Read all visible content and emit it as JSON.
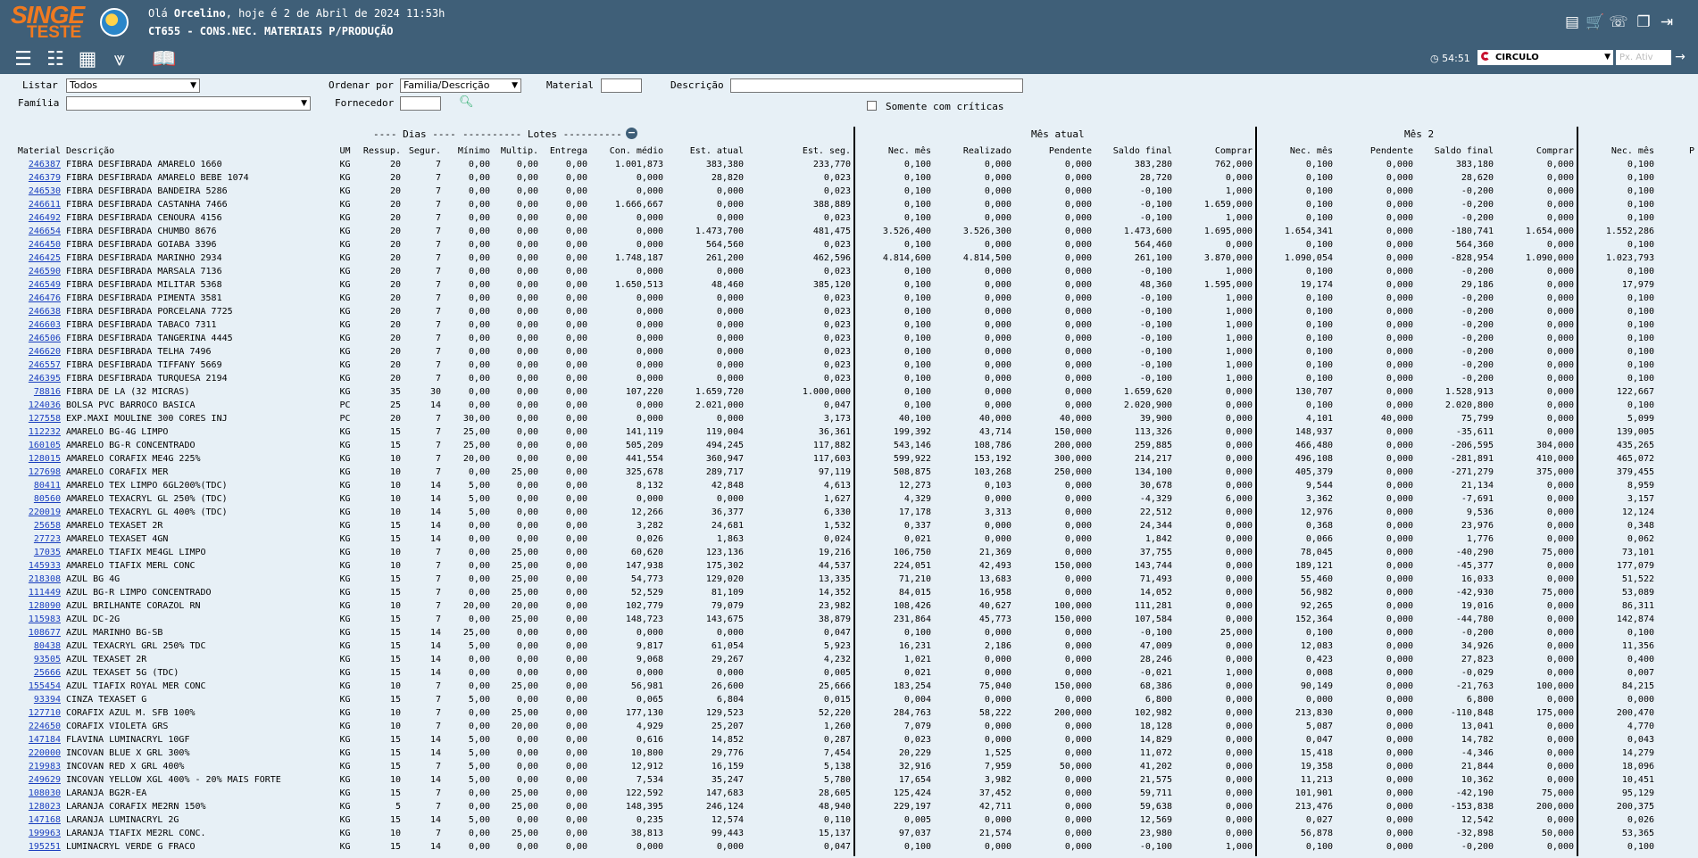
{
  "header": {
    "logo_top": "SINGE",
    "logo_bottom": "TESTE",
    "greeting_prefix": "Olá ",
    "user": "Orcelino",
    "greeting_suffix": ", hoje é 2 de Abril de 2024 11:53h",
    "page_title": "CT655 - CONS.NEC. MATERIAIS P/PRODUÇÃO"
  },
  "toolbar2": {
    "timer": "54:51",
    "empresa": "CIRCULO",
    "px_ativ_placeholder": "Px. Ativ"
  },
  "filters": {
    "listar_label": "Listar",
    "listar_value": "Todos",
    "familia_label": "Família",
    "ordenar_label": "Ordenar por",
    "ordenar_value": "Familia/Descrição",
    "fornecedor_label": "Fornecedor",
    "material_label": "Material",
    "descricao_label": "Descrição",
    "somente_label": "Somente com críticas"
  },
  "groups": {
    "dias": "---- Dias ----",
    "lotes": "---------- Lotes ----------",
    "mes_atual": "Mês atual",
    "mes2": "Mês 2"
  },
  "columns": [
    "Material",
    "Descrição",
    "UM",
    "Ressup.",
    "Segur.",
    "Mínimo",
    "Multip.",
    "Entrega",
    "Con. médio",
    "Est. atual",
    "Est. seg.",
    "Nec. mês",
    "Realizado",
    "Pendente",
    "Saldo final",
    "Comprar",
    "Nec. mês",
    "Pendente",
    "Saldo final",
    "Comprar",
    "Nec. mês",
    "P"
  ],
  "rows": [
    [
      "246387",
      "FIBRA DESFIBRADA AMARELO 1660",
      "KG",
      "20",
      "7",
      "0,00",
      "0,00",
      "0,00",
      "1.001,873",
      "383,380",
      "233,770",
      "0,100",
      "0,000",
      "0,000",
      "383,280",
      "762,000",
      "0,100",
      "0,000",
      "383,180",
      "0,000",
      "0,100"
    ],
    [
      "246379",
      "FIBRA DESFIBRADA AMARELO BEBE 1074",
      "KG",
      "20",
      "7",
      "0,00",
      "0,00",
      "0,00",
      "0,000",
      "28,820",
      "0,023",
      "0,100",
      "0,000",
      "0,000",
      "28,720",
      "0,000",
      "0,100",
      "0,000",
      "28,620",
      "0,000",
      "0,100"
    ],
    [
      "246530",
      "FIBRA DESFIBRADA BANDEIRA 5286",
      "KG",
      "20",
      "7",
      "0,00",
      "0,00",
      "0,00",
      "0,000",
      "0,000",
      "0,023",
      "0,100",
      "0,000",
      "0,000",
      "-0,100",
      "1,000",
      "0,100",
      "0,000",
      "-0,200",
      "0,000",
      "0,100"
    ],
    [
      "246611",
      "FIBRA DESFIBRADA CASTANHA 7466",
      "KG",
      "20",
      "7",
      "0,00",
      "0,00",
      "0,00",
      "1.666,667",
      "0,000",
      "388,889",
      "0,100",
      "0,000",
      "0,000",
      "-0,100",
      "1.659,000",
      "0,100",
      "0,000",
      "-0,200",
      "0,000",
      "0,100"
    ],
    [
      "246492",
      "FIBRA DESFIBRADA CENOURA 4156",
      "KG",
      "20",
      "7",
      "0,00",
      "0,00",
      "0,00",
      "0,000",
      "0,000",
      "0,023",
      "0,100",
      "0,000",
      "0,000",
      "-0,100",
      "1,000",
      "0,100",
      "0,000",
      "-0,200",
      "0,000",
      "0,100"
    ],
    [
      "246654",
      "FIBRA DESFIBRADA CHUMBO 8676",
      "KG",
      "20",
      "7",
      "0,00",
      "0,00",
      "0,00",
      "0,000",
      "1.473,700",
      "481,475",
      "3.526,400",
      "3.526,300",
      "0,000",
      "1.473,600",
      "1.695,000",
      "1.654,341",
      "0,000",
      "-180,741",
      "1.654,000",
      "1.552,286"
    ],
    [
      "246450",
      "FIBRA DESFIBRADA GOIABA 3396",
      "KG",
      "20",
      "7",
      "0,00",
      "0,00",
      "0,00",
      "0,000",
      "564,560",
      "0,023",
      "0,100",
      "0,000",
      "0,000",
      "564,460",
      "0,000",
      "0,100",
      "0,000",
      "564,360",
      "0,000",
      "0,100"
    ],
    [
      "246425",
      "FIBRA DESFIBRADA MARINHO 2934",
      "KG",
      "20",
      "7",
      "0,00",
      "0,00",
      "0,00",
      "1.748,187",
      "261,200",
      "462,596",
      "4.814,600",
      "4.814,500",
      "0,000",
      "261,100",
      "3.870,000",
      "1.090,054",
      "0,000",
      "-828,954",
      "1.090,000",
      "1.023,793"
    ],
    [
      "246590",
      "FIBRA DESFIBRADA MARSALA 7136",
      "KG",
      "20",
      "7",
      "0,00",
      "0,00",
      "0,00",
      "0,000",
      "0,000",
      "0,023",
      "0,100",
      "0,000",
      "0,000",
      "-0,100",
      "1,000",
      "0,100",
      "0,000",
      "-0,200",
      "0,000",
      "0,100"
    ],
    [
      "246549",
      "FIBRA DESFIBRADA MILITAR 5368",
      "KG",
      "20",
      "7",
      "0,00",
      "0,00",
      "0,00",
      "1.650,513",
      "48,460",
      "385,120",
      "0,100",
      "0,000",
      "0,000",
      "48,360",
      "1.595,000",
      "19,174",
      "0,000",
      "29,186",
      "0,000",
      "17,979"
    ],
    [
      "246476",
      "FIBRA DESFIBRADA PIMENTA 3581",
      "KG",
      "20",
      "7",
      "0,00",
      "0,00",
      "0,00",
      "0,000",
      "0,000",
      "0,023",
      "0,100",
      "0,000",
      "0,000",
      "-0,100",
      "1,000",
      "0,100",
      "0,000",
      "-0,200",
      "0,000",
      "0,100"
    ],
    [
      "246638",
      "FIBRA DESFIBRADA PORCELANA 7725",
      "KG",
      "20",
      "7",
      "0,00",
      "0,00",
      "0,00",
      "0,000",
      "0,000",
      "0,023",
      "0,100",
      "0,000",
      "0,000",
      "-0,100",
      "1,000",
      "0,100",
      "0,000",
      "-0,200",
      "0,000",
      "0,100"
    ],
    [
      "246603",
      "FIBRA DESFIBRADA TABACO 7311",
      "KG",
      "20",
      "7",
      "0,00",
      "0,00",
      "0,00",
      "0,000",
      "0,000",
      "0,023",
      "0,100",
      "0,000",
      "0,000",
      "-0,100",
      "1,000",
      "0,100",
      "0,000",
      "-0,200",
      "0,000",
      "0,100"
    ],
    [
      "246506",
      "FIBRA DESFIBRADA TANGERINA 4445",
      "KG",
      "20",
      "7",
      "0,00",
      "0,00",
      "0,00",
      "0,000",
      "0,000",
      "0,023",
      "0,100",
      "0,000",
      "0,000",
      "-0,100",
      "1,000",
      "0,100",
      "0,000",
      "-0,200",
      "0,000",
      "0,100"
    ],
    [
      "246620",
      "FIBRA DESFIBRADA TELHA 7496",
      "KG",
      "20",
      "7",
      "0,00",
      "0,00",
      "0,00",
      "0,000",
      "0,000",
      "0,023",
      "0,100",
      "0,000",
      "0,000",
      "-0,100",
      "1,000",
      "0,100",
      "0,000",
      "-0,200",
      "0,000",
      "0,100"
    ],
    [
      "246557",
      "FIBRA DESFIBRADA TIFFANY 5669",
      "KG",
      "20",
      "7",
      "0,00",
      "0,00",
      "0,00",
      "0,000",
      "0,000",
      "0,023",
      "0,100",
      "0,000",
      "0,000",
      "-0,100",
      "1,000",
      "0,100",
      "0,000",
      "-0,200",
      "0,000",
      "0,100"
    ],
    [
      "246395",
      "FIBRA DESFIBRADA TURQUESA 2194",
      "KG",
      "20",
      "7",
      "0,00",
      "0,00",
      "0,00",
      "0,000",
      "0,000",
      "0,023",
      "0,100",
      "0,000",
      "0,000",
      "-0,100",
      "1,000",
      "0,100",
      "0,000",
      "-0,200",
      "0,000",
      "0,100"
    ],
    [
      "78816",
      "FIBRA DE LA (32 MICRAS)",
      "KG",
      "35",
      "30",
      "0,00",
      "0,00",
      "0,00",
      "107,220",
      "1.659,720",
      "1.000,000",
      "0,100",
      "0,000",
      "0,000",
      "1.659,620",
      "0,000",
      "130,707",
      "0,000",
      "1.528,913",
      "0,000",
      "122,667"
    ],
    [
      "124036",
      "BOLSA PVC BARROCO BASICA",
      "PC",
      "25",
      "14",
      "0,00",
      "0,00",
      "0,00",
      "0,000",
      "2.021,000",
      "0,047",
      "0,100",
      "0,000",
      "0,000",
      "2.020,900",
      "0,000",
      "0,100",
      "0,000",
      "2.020,800",
      "0,000",
      "0,100"
    ],
    [
      "127558",
      "EXP.MAXI MOULINE 300 CORES INJ",
      "PC",
      "20",
      "7",
      "30,00",
      "0,00",
      "0,00",
      "0,000",
      "0,000",
      "3,173",
      "40,100",
      "40,000",
      "40,000",
      "39,900",
      "0,000",
      "4,101",
      "40,000",
      "75,799",
      "0,000",
      "5,099"
    ],
    [
      "112232",
      "AMARELO BG-4G LIMPO",
      "KG",
      "15",
      "7",
      "25,00",
      "0,00",
      "0,00",
      "141,119",
      "119,004",
      "36,361",
      "199,392",
      "43,714",
      "150,000",
      "113,326",
      "0,000",
      "148,937",
      "0,000",
      "-35,611",
      "0,000",
      "139,005"
    ],
    [
      "160105",
      "AMARELO BG-R CONCENTRADO",
      "KG",
      "15",
      "7",
      "25,00",
      "0,00",
      "0,00",
      "505,209",
      "494,245",
      "117,882",
      "543,146",
      "108,786",
      "200,000",
      "259,885",
      "0,000",
      "466,480",
      "0,000",
      "-206,595",
      "304,000",
      "435,265"
    ],
    [
      "128015",
      "AMARELO CORAFIX ME4G 225%",
      "KG",
      "10",
      "7",
      "20,00",
      "0,00",
      "0,00",
      "441,554",
      "360,947",
      "117,603",
      "599,922",
      "153,192",
      "300,000",
      "214,217",
      "0,000",
      "496,108",
      "0,000",
      "-281,891",
      "410,000",
      "465,072"
    ],
    [
      "127698",
      "AMARELO CORAFIX MER",
      "KG",
      "10",
      "7",
      "0,00",
      "25,00",
      "0,00",
      "325,678",
      "289,717",
      "97,119",
      "508,875",
      "103,268",
      "250,000",
      "134,100",
      "0,000",
      "405,379",
      "0,000",
      "-271,279",
      "375,000",
      "379,455"
    ],
    [
      "80411",
      "AMARELO TEX LIMPO 6GL200%(TDC)",
      "KG",
      "10",
      "14",
      "5,00",
      "0,00",
      "0,00",
      "8,132",
      "42,848",
      "4,613",
      "12,273",
      "0,103",
      "0,000",
      "30,678",
      "0,000",
      "9,544",
      "0,000",
      "21,134",
      "0,000",
      "8,959"
    ],
    [
      "80560",
      "AMARELO TEXACRYL GL 250% (TDC)",
      "KG",
      "10",
      "14",
      "5,00",
      "0,00",
      "0,00",
      "0,000",
      "0,000",
      "1,627",
      "4,329",
      "0,000",
      "0,000",
      "-4,329",
      "6,000",
      "3,362",
      "0,000",
      "-7,691",
      "0,000",
      "3,157"
    ],
    [
      "220019",
      "AMARELO TEXACRYL GL 400% (TDC)",
      "KG",
      "10",
      "14",
      "5,00",
      "0,00",
      "0,00",
      "12,266",
      "36,377",
      "6,330",
      "17,178",
      "3,313",
      "0,000",
      "22,512",
      "0,000",
      "12,976",
      "0,000",
      "9,536",
      "0,000",
      "12,124"
    ],
    [
      "25658",
      "AMARELO TEXASET 2R",
      "KG",
      "15",
      "14",
      "0,00",
      "0,00",
      "0,00",
      "3,282",
      "24,681",
      "1,532",
      "0,337",
      "0,000",
      "0,000",
      "24,344",
      "0,000",
      "0,368",
      "0,000",
      "23,976",
      "0,000",
      "0,348"
    ],
    [
      "27723",
      "AMARELO TEXASET 4GN",
      "KG",
      "15",
      "14",
      "0,00",
      "0,00",
      "0,00",
      "0,026",
      "1,863",
      "0,024",
      "0,021",
      "0,000",
      "0,000",
      "1,842",
      "0,000",
      "0,066",
      "0,000",
      "1,776",
      "0,000",
      "0,062"
    ],
    [
      "17035",
      "AMARELO TIAFIX ME4GL LIMPO",
      "KG",
      "10",
      "7",
      "0,00",
      "25,00",
      "0,00",
      "60,620",
      "123,136",
      "19,216",
      "106,750",
      "21,369",
      "0,000",
      "37,755",
      "0,000",
      "78,045",
      "0,000",
      "-40,290",
      "75,000",
      "73,101"
    ],
    [
      "145933",
      "AMARELO TIAFIX MERL CONC",
      "KG",
      "10",
      "7",
      "0,00",
      "25,00",
      "0,00",
      "147,938",
      "175,302",
      "44,537",
      "224,051",
      "42,493",
      "150,000",
      "143,744",
      "0,000",
      "189,121",
      "0,000",
      "-45,377",
      "0,000",
      "177,079"
    ],
    [
      "218308",
      "AZUL BG 4G",
      "KG",
      "15",
      "7",
      "0,00",
      "25,00",
      "0,00",
      "54,773",
      "129,020",
      "13,335",
      "71,210",
      "13,683",
      "0,000",
      "71,493",
      "0,000",
      "55,460",
      "0,000",
      "16,033",
      "0,000",
      "51,522"
    ],
    [
      "111449",
      "AZUL BG-R LIMPO CONCENTRADO",
      "KG",
      "15",
      "7",
      "0,00",
      "25,00",
      "0,00",
      "52,529",
      "81,109",
      "14,352",
      "84,015",
      "16,958",
      "0,000",
      "14,052",
      "0,000",
      "56,982",
      "0,000",
      "-42,930",
      "75,000",
      "53,089"
    ],
    [
      "128090",
      "AZUL BRILHANTE CORAZOL RN",
      "KG",
      "10",
      "7",
      "20,00",
      "20,00",
      "0,00",
      "102,779",
      "79,079",
      "23,982",
      "108,426",
      "40,627",
      "100,000",
      "111,281",
      "0,000",
      "92,265",
      "0,000",
      "19,016",
      "0,000",
      "86,311"
    ],
    [
      "115983",
      "AZUL DC-2G",
      "KG",
      "15",
      "7",
      "0,00",
      "25,00",
      "0,00",
      "148,723",
      "143,675",
      "38,879",
      "231,864",
      "45,773",
      "150,000",
      "107,584",
      "0,000",
      "152,364",
      "0,000",
      "-44,780",
      "0,000",
      "142,874"
    ],
    [
      "108677",
      "AZUL MARINHO BG-SB",
      "KG",
      "15",
      "14",
      "25,00",
      "0,00",
      "0,00",
      "0,000",
      "0,000",
      "0,047",
      "0,100",
      "0,000",
      "0,000",
      "-0,100",
      "25,000",
      "0,100",
      "0,000",
      "-0,200",
      "0,000",
      "0,100"
    ],
    [
      "80438",
      "AZUL TEXACRYL GRL 250% TDC",
      "KG",
      "15",
      "14",
      "5,00",
      "0,00",
      "0,00",
      "9,817",
      "61,054",
      "5,923",
      "16,231",
      "2,186",
      "0,000",
      "47,009",
      "0,000",
      "12,083",
      "0,000",
      "34,926",
      "0,000",
      "11,356"
    ],
    [
      "93505",
      "AZUL TEXASET 2R",
      "KG",
      "15",
      "14",
      "0,00",
      "0,00",
      "0,00",
      "9,068",
      "29,267",
      "4,232",
      "1,021",
      "0,000",
      "0,000",
      "28,246",
      "0,000",
      "0,423",
      "0,000",
      "27,823",
      "0,000",
      "0,400"
    ],
    [
      "25666",
      "AZUL TEXASET 5G (TDC)",
      "KG",
      "15",
      "14",
      "0,00",
      "0,00",
      "0,00",
      "0,000",
      "0,000",
      "0,005",
      "0,021",
      "0,000",
      "0,000",
      "-0,021",
      "1,000",
      "0,008",
      "0,000",
      "-0,029",
      "0,000",
      "0,007"
    ],
    [
      "155454",
      "AZUL TIAFIX ROYAL MER CONC",
      "KG",
      "10",
      "7",
      "0,00",
      "25,00",
      "0,00",
      "56,981",
      "26,600",
      "25,666",
      "183,254",
      "75,040",
      "150,000",
      "68,386",
      "0,000",
      "90,149",
      "0,000",
      "-21,763",
      "100,000",
      "84,215"
    ],
    [
      "93394",
      "CINZA TEXASET G",
      "KG",
      "15",
      "7",
      "5,00",
      "0,00",
      "0,00",
      "0,065",
      "6,804",
      "0,015",
      "0,004",
      "0,000",
      "0,000",
      "6,800",
      "0,000",
      "0,000",
      "0,000",
      "6,800",
      "0,000",
      "0,000"
    ],
    [
      "127710",
      "CORAFIX AZUL M. SFB 100%",
      "KG",
      "10",
      "7",
      "0,00",
      "25,00",
      "0,00",
      "177,130",
      "129,523",
      "52,220",
      "284,763",
      "58,222",
      "200,000",
      "102,982",
      "0,000",
      "213,830",
      "0,000",
      "-110,848",
      "175,000",
      "200,470"
    ],
    [
      "224650",
      "CORAFIX VIOLETA GRS",
      "KG",
      "10",
      "7",
      "0,00",
      "20,00",
      "0,00",
      "4,929",
      "25,207",
      "1,260",
      "7,079",
      "0,000",
      "0,000",
      "18,128",
      "0,000",
      "5,087",
      "0,000",
      "13,041",
      "0,000",
      "4,770"
    ],
    [
      "147184",
      "FLAVINA LUMINACRYL 10GF",
      "KG",
      "15",
      "14",
      "5,00",
      "0,00",
      "0,00",
      "0,616",
      "14,852",
      "0,287",
      "0,023",
      "0,000",
      "0,000",
      "14,829",
      "0,000",
      "0,047",
      "0,000",
      "14,782",
      "0,000",
      "0,043"
    ],
    [
      "220000",
      "INCOVAN BLUE X GRL 300%",
      "KG",
      "15",
      "14",
      "5,00",
      "0,00",
      "0,00",
      "10,800",
      "29,776",
      "7,454",
      "20,229",
      "1,525",
      "0,000",
      "11,072",
      "0,000",
      "15,418",
      "0,000",
      "-4,346",
      "0,000",
      "14,279"
    ],
    [
      "219983",
      "INCOVAN RED X GRL 400%",
      "KG",
      "15",
      "7",
      "5,00",
      "0,00",
      "0,00",
      "12,912",
      "16,159",
      "5,138",
      "32,916",
      "7,959",
      "50,000",
      "41,202",
      "0,000",
      "19,358",
      "0,000",
      "21,844",
      "0,000",
      "18,096"
    ],
    [
      "249629",
      "INCOVAN YELLOW XGL 400% - 20% MAIS FORTE",
      "KG",
      "10",
      "14",
      "5,00",
      "0,00",
      "0,00",
      "7,534",
      "35,247",
      "5,780",
      "17,654",
      "3,982",
      "0,000",
      "21,575",
      "0,000",
      "11,213",
      "0,000",
      "10,362",
      "0,000",
      "10,451"
    ],
    [
      "108030",
      "LARANJA BG2R-EA",
      "KG",
      "15",
      "7",
      "0,00",
      "25,00",
      "0,00",
      "122,592",
      "147,683",
      "28,605",
      "125,424",
      "37,452",
      "0,000",
      "59,711",
      "0,000",
      "101,901",
      "0,000",
      "-42,190",
      "75,000",
      "95,129"
    ],
    [
      "128023",
      "LARANJA CORAFIX ME2RN 150%",
      "KG",
      "5",
      "7",
      "0,00",
      "25,00",
      "0,00",
      "148,395",
      "246,124",
      "48,940",
      "229,197",
      "42,711",
      "0,000",
      "59,638",
      "0,000",
      "213,476",
      "0,000",
      "-153,838",
      "200,000",
      "200,375"
    ],
    [
      "147168",
      "LARANJA LUMINACRYL 2G",
      "KG",
      "15",
      "14",
      "5,00",
      "0,00",
      "0,00",
      "0,235",
      "12,574",
      "0,110",
      "0,005",
      "0,000",
      "0,000",
      "12,569",
      "0,000",
      "0,027",
      "0,000",
      "12,542",
      "0,000",
      "0,026"
    ],
    [
      "199963",
      "LARANJA TIAFIX ME2RL CONC.",
      "KG",
      "10",
      "7",
      "0,00",
      "25,00",
      "0,00",
      "38,813",
      "99,443",
      "15,137",
      "97,037",
      "21,574",
      "0,000",
      "23,980",
      "0,000",
      "56,878",
      "0,000",
      "-32,898",
      "50,000",
      "53,365"
    ],
    [
      "195251",
      "LUMINACRYL VERDE G FRACO",
      "KG",
      "15",
      "14",
      "0,00",
      "0,00",
      "0,00",
      "0,000",
      "0,000",
      "0,047",
      "0,100",
      "0,000",
      "0,000",
      "-0,100",
      "1,000",
      "0,100",
      "0,000",
      "-0,200",
      "0,000",
      "0,100"
    ]
  ]
}
